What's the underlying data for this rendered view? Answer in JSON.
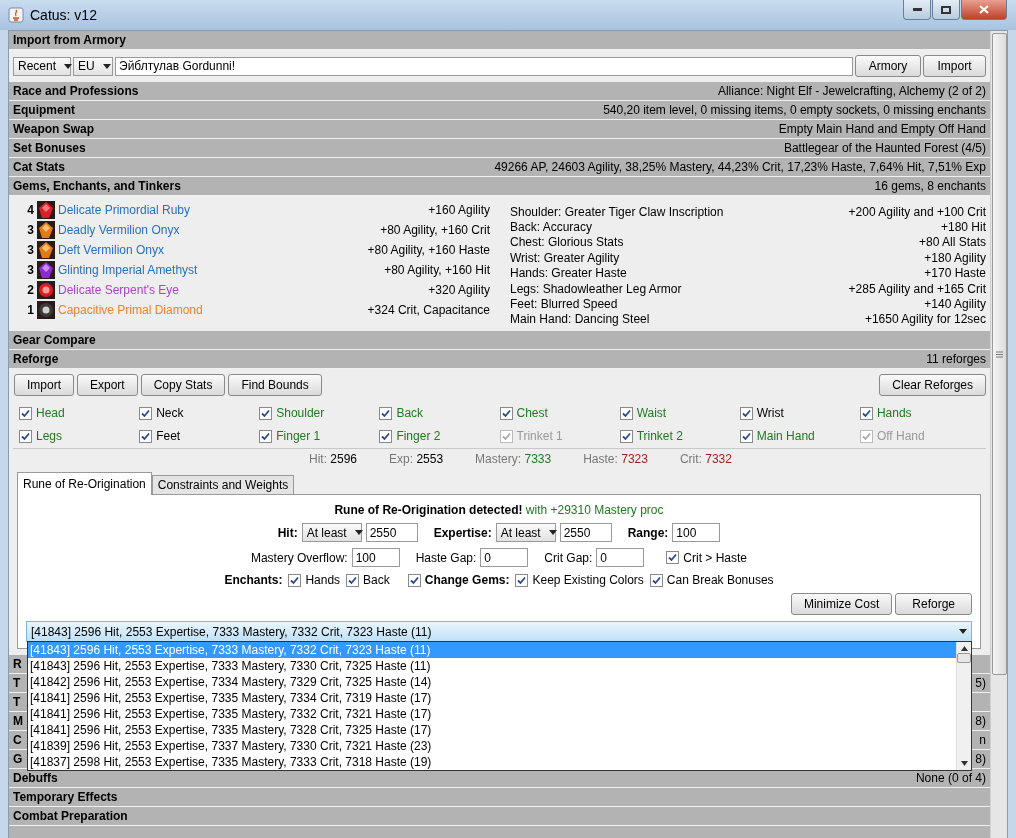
{
  "window": {
    "title": "Catus: v12"
  },
  "import": {
    "title": "Import from Armory",
    "recent": "Recent",
    "region": "EU",
    "name": "Эйблтулав Gordunni!",
    "buttons": [
      "Armory",
      "Import"
    ]
  },
  "sections": [
    {
      "title": "Race and Professions",
      "summary": "Alliance: Night Elf - Jewelcrafting, Alchemy (2 of 2)"
    },
    {
      "title": "Equipment",
      "summary": "540,20 item level, 0 missing items, 0 empty sockets, 0 missing enchants"
    },
    {
      "title": "Weapon Swap",
      "summary": "Empty Main Hand and Empty Off Hand"
    },
    {
      "title": "Set Bonuses",
      "summary": "Battlegear of the Haunted Forest (4/5)"
    },
    {
      "title": "Cat Stats",
      "summary": "49266 AP, 24603 Agility, 38,25% Mastery, 44,23% Crit, 17,23% Haste, 7,64% Hit, 7,51% Exp"
    },
    {
      "title": "Gems, Enchants, and Tinkers",
      "summary": "16 gems, 8 enchants"
    }
  ],
  "gems": [
    {
      "count": "4",
      "kind": "ruby",
      "name": "Delicate Primordial Ruby",
      "color": "#2470c6",
      "stats": "+160 Agility"
    },
    {
      "count": "3",
      "kind": "onyx",
      "name": "Deadly Vermilion Onyx",
      "color": "#2470c6",
      "stats": "+80 Agility, +160 Crit"
    },
    {
      "count": "3",
      "kind": "onyx",
      "name": "Deft Vermilion Onyx",
      "color": "#2470c6",
      "stats": "+80 Agility, +160 Haste"
    },
    {
      "count": "3",
      "kind": "amethyst",
      "name": "Glinting Imperial Amethyst",
      "color": "#2470c6",
      "stats": "+80 Agility, +160 Hit"
    },
    {
      "count": "2",
      "kind": "eye",
      "name": "Delicate Serpent's Eye",
      "color": "#b23fd0",
      "stats": "+320 Agility"
    },
    {
      "count": "1",
      "kind": "diamond",
      "name": "Capacitive Primal Diamond",
      "color": "#ef8423",
      "stats": "+324 Crit, Capacitance"
    }
  ],
  "enchants": [
    {
      "slot": "Shoulder: Greater Tiger Claw Inscription",
      "bonus": "+200 Agility and +100 Crit"
    },
    {
      "slot": "Back: Accuracy",
      "bonus": "+180 Hit"
    },
    {
      "slot": "Chest: Glorious Stats",
      "bonus": "+80 All Stats"
    },
    {
      "slot": "Wrist: Greater Agility",
      "bonus": "+180 Agility"
    },
    {
      "slot": "Hands: Greater Haste",
      "bonus": "+170 Haste"
    },
    {
      "slot": "Legs: Shadowleather Leg Armor",
      "bonus": "+285 Agility and +165 Crit"
    },
    {
      "slot": "Feet: Blurred Speed",
      "bonus": "+140 Agility"
    },
    {
      "slot": "Main Hand: Dancing Steel",
      "bonus": "+1650 Agility for 12sec"
    }
  ],
  "gear_compare": {
    "title": "Gear Compare"
  },
  "reforge": {
    "title": "Reforge",
    "summary": "11 reforges",
    "buttons": [
      "Import",
      "Export",
      "Copy Stats",
      "Find Bounds"
    ],
    "clear_button": "Clear Reforges",
    "slots": [
      {
        "label": "Head",
        "checked": true,
        "disabled": false,
        "color": "#1e7a1e"
      },
      {
        "label": "Neck",
        "checked": true,
        "disabled": false,
        "color": "#000000"
      },
      {
        "label": "Shoulder",
        "checked": true,
        "disabled": false,
        "color": "#1e7a1e"
      },
      {
        "label": "Back",
        "checked": true,
        "disabled": false,
        "color": "#1e7a1e"
      },
      {
        "label": "Chest",
        "checked": true,
        "disabled": false,
        "color": "#1e7a1e"
      },
      {
        "label": "Waist",
        "checked": true,
        "disabled": false,
        "color": "#1e7a1e"
      },
      {
        "label": "Wrist",
        "checked": true,
        "disabled": false,
        "color": "#000000"
      },
      {
        "label": "Hands",
        "checked": true,
        "disabled": false,
        "color": "#1e7a1e"
      },
      {
        "label": "Legs",
        "checked": true,
        "disabled": false,
        "color": "#1e7a1e"
      },
      {
        "label": "Feet",
        "checked": true,
        "disabled": false,
        "color": "#000000"
      },
      {
        "label": "Finger 1",
        "checked": true,
        "disabled": false,
        "color": "#1e7a1e"
      },
      {
        "label": "Finger 2",
        "checked": true,
        "disabled": false,
        "color": "#1e7a1e"
      },
      {
        "label": "Trinket 1",
        "checked": true,
        "disabled": true,
        "color": "#999999"
      },
      {
        "label": "Trinket 2",
        "checked": true,
        "disabled": false,
        "color": "#1e7a1e"
      },
      {
        "label": "Main Hand",
        "checked": true,
        "disabled": false,
        "color": "#1e7a1e"
      },
      {
        "label": "Off Hand",
        "checked": true,
        "disabled": true,
        "color": "#999999"
      }
    ],
    "stats": [
      {
        "label": "Hit:",
        "value": "2596",
        "color": "#000000"
      },
      {
        "label": "Exp:",
        "value": "2553",
        "color": "#000000"
      },
      {
        "label": "Mastery:",
        "value": "7333",
        "color": "#1e7a1e"
      },
      {
        "label": "Haste:",
        "value": "7323",
        "color": "#9b1c1c"
      },
      {
        "label": "Crit:",
        "value": "7332",
        "color": "#9b1c1c"
      }
    ]
  },
  "tabs": [
    {
      "label": "Rune of Re-Origination",
      "selected": true
    },
    {
      "label": "Constraints and Weights",
      "selected": false
    }
  ],
  "rune_panel": {
    "notice": "**Rune of Re-Origination detected!** with +29310 Mastery proc",
    "hit": {
      "label": "Hit:",
      "mode": "At least",
      "value": "2550"
    },
    "expertise": {
      "label": "Expertise:",
      "mode": "At least",
      "value": "2550"
    },
    "range": {
      "label": "Range:",
      "value": "100"
    },
    "gaps": [
      {
        "label": "Mastery Overflow:",
        "value": "100"
      },
      {
        "label": "Haste Gap:",
        "value": "0"
      },
      {
        "label": "Crit Gap:",
        "value": "0"
      }
    ],
    "crit_over_haste": {
      "label": "Crit > Haste",
      "checked": true
    },
    "enchants_label": "Enchants:",
    "enchant_options": [
      {
        "label": "Hands",
        "checked": true
      },
      {
        "label": "Back",
        "checked": true
      }
    ],
    "gem_options": [
      {
        "label": "Change Gems:",
        "checked": true,
        "kind": "heading"
      },
      {
        "label": "Keep Existing Colors",
        "checked": true,
        "kind": "plain"
      },
      {
        "label": "Can Break Bonuses",
        "checked": true,
        "kind": "plain"
      }
    ],
    "buttons": [
      "Minimize Cost",
      "Reforge"
    ],
    "result": {
      "value": "[41843] 2596 Hit, 2553 Expertise, 7333 Mastery, 7332 Crit, 7323 Haste (11)",
      "options": [
        {
          "label": "[41843] 2596 Hit, 2553 Expertise, 7333 Mastery, 7332 Crit, 7323 Haste (11)",
          "selected": true
        },
        {
          "label": "[41843] 2596 Hit, 2553 Expertise, 7333 Mastery, 7330 Crit, 7325 Haste (11)",
          "selected": false
        },
        {
          "label": "[41842] 2596 Hit, 2553 Expertise, 7334 Mastery, 7329 Crit, 7325 Haste (14)",
          "selected": false
        },
        {
          "label": "[41841] 2596 Hit, 2553 Expertise, 7335 Mastery, 7334 Crit, 7319 Haste (17)",
          "selected": false
        },
        {
          "label": "[41841] 2596 Hit, 2553 Expertise, 7335 Mastery, 7332 Crit, 7321 Haste (17)",
          "selected": false
        },
        {
          "label": "[41841] 2596 Hit, 2553 Expertise, 7335 Mastery, 7328 Crit, 7325 Haste (17)",
          "selected": false
        },
        {
          "label": "[41839] 2596 Hit, 2553 Expertise, 7337 Mastery, 7330 Crit, 7321 Haste (23)",
          "selected": false
        },
        {
          "label": "[41837] 2598 Hit, 2553 Expertise, 7335 Mastery, 7333 Crit, 7318 Haste (19)",
          "selected": false
        }
      ]
    }
  },
  "lower_sections": [
    {
      "title": "R"
    },
    {
      "title": "T",
      "summary": "5)"
    },
    {
      "title": "T"
    },
    {
      "title": "M",
      "summary": "8)"
    },
    {
      "title": "C",
      "summary": "n"
    },
    {
      "title": "G",
      "summary": "8)"
    },
    {
      "title": "Debuffs",
      "summary": "None (0 of 4)"
    },
    {
      "title": "Temporary Effects"
    },
    {
      "title": "Combat Preparation"
    }
  ]
}
